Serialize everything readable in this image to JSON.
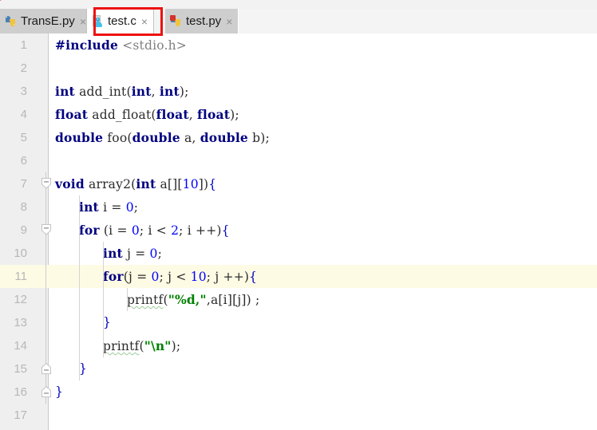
{
  "window": {
    "app": "code-editor",
    "breadcrumb_left": "▸",
    "breadcrumb_trail": "/                              /"
  },
  "tabs": [
    {
      "label": "TransE.py",
      "icon": "python-file-icon",
      "active": false,
      "close": "×"
    },
    {
      "label": "test.c",
      "icon": "c-file-icon",
      "active": true,
      "close": "×"
    },
    {
      "label": "test.py",
      "icon": "python-modified-file-icon",
      "active": false,
      "close": "×"
    }
  ],
  "annotation": {
    "type": "highlight-rectangle",
    "color": "#ee1111",
    "target": "test.c"
  },
  "editor": {
    "file": "test.c",
    "highlighted_line": 11,
    "highlight_color": "#fdfbe4",
    "gutter_bg": "#efefef",
    "colors": {
      "keyword": "#000080",
      "number": "#0000ff",
      "string": "#008000",
      "include_path": "#808080",
      "identifier": "#2b2b2b",
      "brace": "#0000c0"
    },
    "lines": [
      {
        "n": "1",
        "fold": "none",
        "indent": 0,
        "text": "#include <stdio.h>"
      },
      {
        "n": "2",
        "fold": "none",
        "indent": 0,
        "text": ""
      },
      {
        "n": "3",
        "fold": "none",
        "indent": 0,
        "text": "int add_int(int, int);"
      },
      {
        "n": "4",
        "fold": "none",
        "indent": 0,
        "text": "float add_float(float, float);"
      },
      {
        "n": "5",
        "fold": "none",
        "indent": 0,
        "text": "double foo(double a, double b);"
      },
      {
        "n": "6",
        "fold": "none",
        "indent": 0,
        "text": ""
      },
      {
        "n": "7",
        "fold": "expanded-top",
        "indent": 0,
        "text": "void array2(int a[][10]){"
      },
      {
        "n": "8",
        "fold": "none",
        "indent": 1,
        "text": "int i = 0;"
      },
      {
        "n": "9",
        "fold": "expanded-top",
        "indent": 1,
        "text": "for (i = 0; i < 2; i ++){"
      },
      {
        "n": "10",
        "fold": "none",
        "indent": 2,
        "text": "int  j = 0;"
      },
      {
        "n": "11",
        "fold": "none",
        "indent": 2,
        "text": "for(j = 0; j < 10; j ++){"
      },
      {
        "n": "12",
        "fold": "none",
        "indent": 3,
        "text": "printf(\"%d,\",a[i][j]) ;"
      },
      {
        "n": "13",
        "fold": "none",
        "indent": 2,
        "text": "}"
      },
      {
        "n": "14",
        "fold": "none",
        "indent": 2,
        "text": "printf(\"\\n\");"
      },
      {
        "n": "15",
        "fold": "collapse-end",
        "indent": 1,
        "text": "}"
      },
      {
        "n": "16",
        "fold": "collapse-end",
        "indent": 0,
        "text": "}"
      },
      {
        "n": "17",
        "fold": "none",
        "indent": 0,
        "text": ""
      }
    ]
  }
}
